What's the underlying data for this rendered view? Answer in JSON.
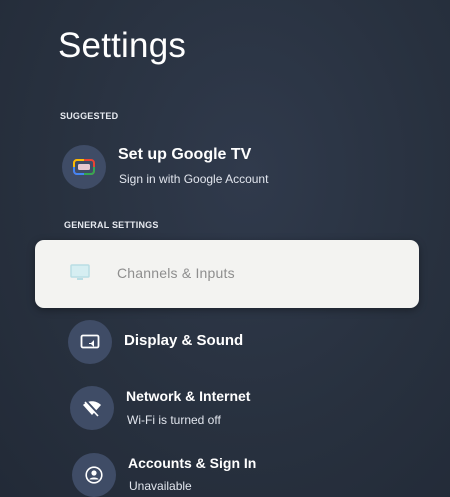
{
  "header": {
    "title": "Settings"
  },
  "sections": {
    "suggested": "SUGGESTED",
    "general": "GENERAL SETTINGS"
  },
  "suggested_item": {
    "title": "Set up Google TV",
    "subtitle": "Sign in with Google Account",
    "icon": "google-tv-icon"
  },
  "items": [
    {
      "title": "Channels & Inputs",
      "icon": "tv-input-icon",
      "focused": true
    },
    {
      "title": "Display & Sound",
      "icon": "display-sound-icon"
    },
    {
      "title": "Network & Internet",
      "subtitle": "Wi-Fi is turned off",
      "icon": "wifi-off-icon"
    },
    {
      "title": "Accounts & Sign In",
      "subtitle": "Unavailable",
      "icon": "account-icon"
    }
  ],
  "colors": {
    "background": "#28313f",
    "icon_circle": "#3f4c66",
    "focus_card": "#f3f3f1",
    "focus_text": "#8e8e8e"
  }
}
